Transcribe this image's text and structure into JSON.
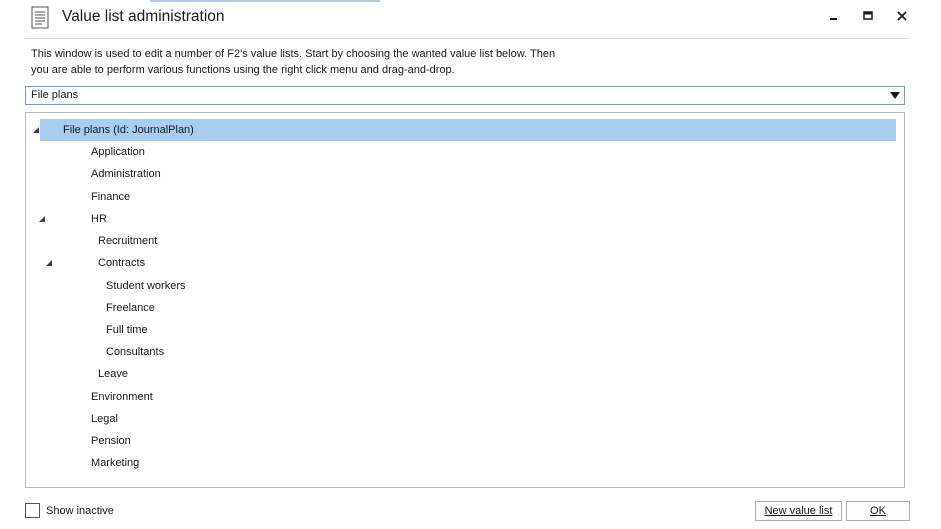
{
  "window": {
    "title": "Value list administration",
    "icons": {
      "app": "document-list-icon",
      "minimize": "minimize-icon",
      "maximize": "maximize-icon",
      "close": "close-icon"
    }
  },
  "description": {
    "line1": "This window is used to edit a number of F2's value lists. Start by choosing the wanted value list below. Then",
    "line2": "you are able to perform various functions using the right click menu and drag-and-drop."
  },
  "value_list_select": {
    "selected": "File plans"
  },
  "tree": {
    "nodes": [
      {
        "label": "File plans (Id: JournalPlan)",
        "expanded": true,
        "selected": true
      },
      {
        "label": "Application"
      },
      {
        "label": "Administration"
      },
      {
        "label": "Finance"
      },
      {
        "label": "HR",
        "expanded": true
      },
      {
        "label": "Recruitment"
      },
      {
        "label": "Contracts",
        "expanded": true
      },
      {
        "label": "Student workers"
      },
      {
        "label": "Freelance"
      },
      {
        "label": "Full time"
      },
      {
        "label": "Consultants"
      },
      {
        "label": "Leave"
      },
      {
        "label": "Environment"
      },
      {
        "label": "Legal"
      },
      {
        "label": "Pension"
      },
      {
        "label": "Marketing"
      }
    ]
  },
  "footer": {
    "show_inactive_label": "Show inactive",
    "show_inactive_checked": false,
    "new_value_list_label": "New value list",
    "ok_label": "OK"
  },
  "colors": {
    "selection": "#a7cdf0",
    "combo_border": "#6f9fd4"
  }
}
